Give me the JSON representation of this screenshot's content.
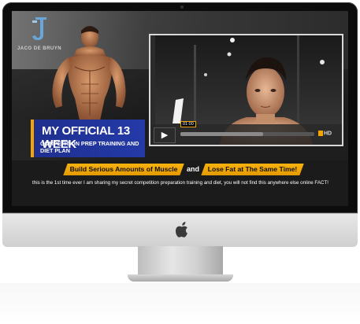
{
  "brand": {
    "logo_text": "JACO DE BRUYN",
    "accent_color": "#f2a400",
    "title_bg_color": "#2238a3"
  },
  "hero": {
    "title": "MY OFFICIAL 13 WEEK",
    "subtitle": "COMPETITION PREP TRAINING AND DIET PLAN"
  },
  "video": {
    "play_icon": "play-icon",
    "time_label": "01:00",
    "hd_label": "HD",
    "buffered_fraction": 0.62
  },
  "banner": {
    "highlight_1": "Build Serious Amounts of Muscle",
    "connector": "and",
    "highlight_2": "Lose Fat at The Same Time!",
    "tagline": "this is the 1st time ever I am sharing my secret competition preparation training and diet,  you will not find this anywhere else online FACT!"
  },
  "device": {
    "apple_icon": "apple-logo-icon"
  }
}
